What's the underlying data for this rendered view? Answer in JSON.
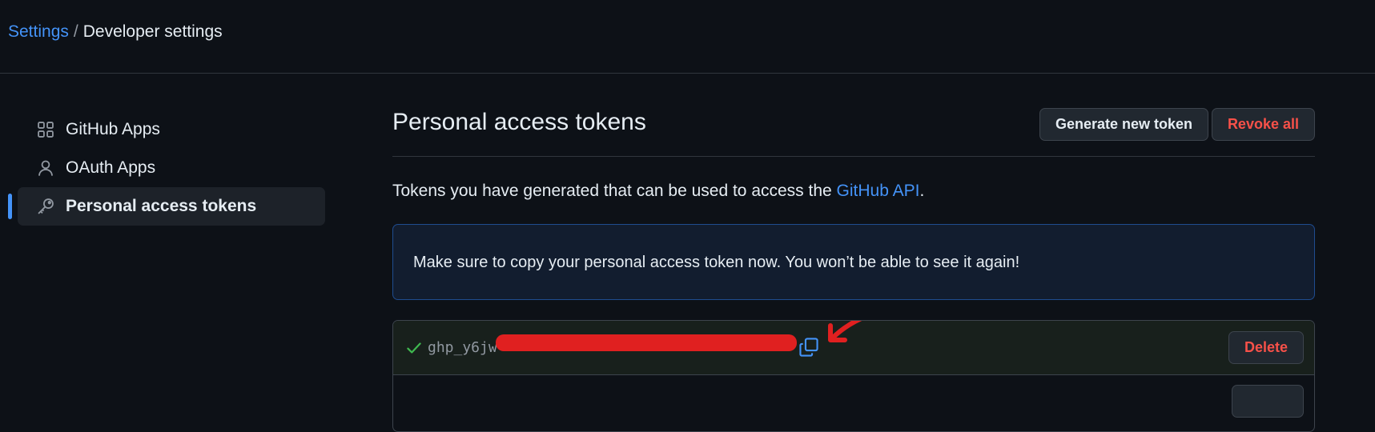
{
  "breadcrumb": {
    "root": "Settings",
    "separator": "/",
    "current": "Developer settings"
  },
  "sidebar": {
    "items": [
      {
        "label": "GitHub Apps",
        "icon": "apps-icon",
        "active": false
      },
      {
        "label": "OAuth Apps",
        "icon": "person-icon",
        "active": false
      },
      {
        "label": "Personal access tokens",
        "icon": "key-icon",
        "active": true
      }
    ]
  },
  "main": {
    "title": "Personal access tokens",
    "generate_label": "Generate new token",
    "revoke_label": "Revoke all",
    "description_prefix": "Tokens you have generated that can be used to access the ",
    "description_link": "GitHub API",
    "description_suffix": ".",
    "flash_message": "Make sure to copy your personal access token now. You won’t be able to see it again!",
    "token": {
      "value_visible": "ghp_y6jw",
      "delete_label": "Delete"
    }
  },
  "colors": {
    "background": "#0d1117",
    "link": "#4493f8",
    "danger": "#f85149",
    "success": "#3fb950",
    "redaction": "#e02020"
  }
}
